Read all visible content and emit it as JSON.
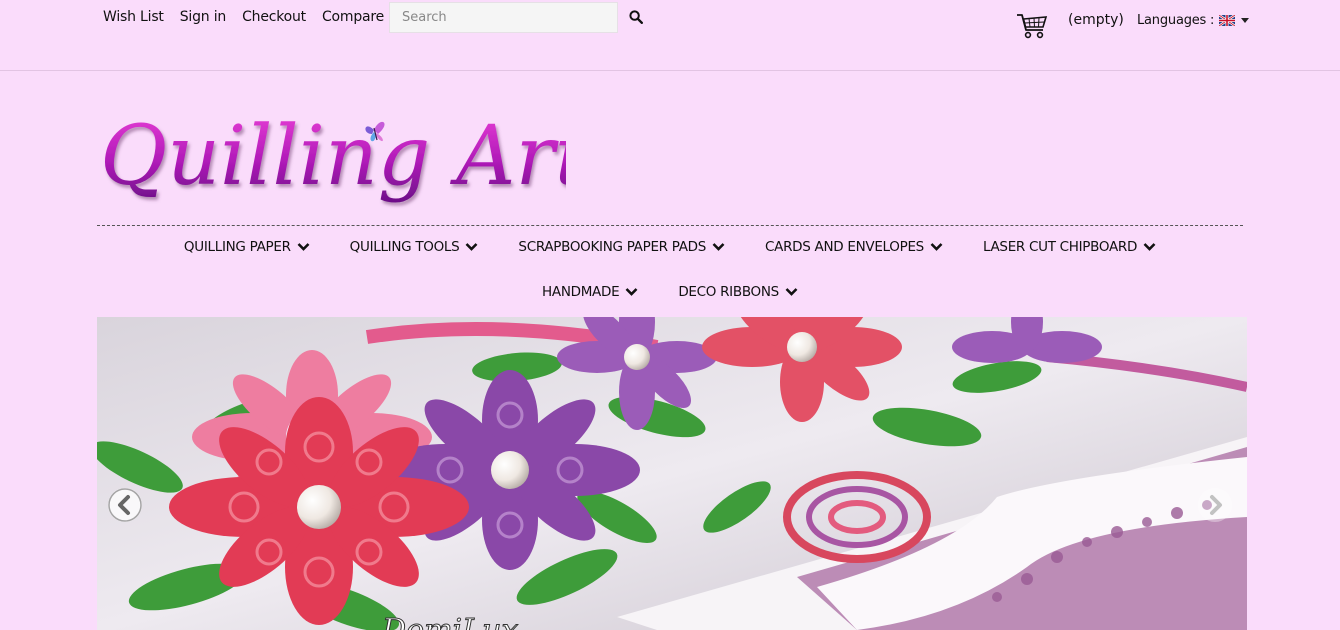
{
  "header": {
    "links": [
      "Wish List",
      "Sign in",
      "Checkout",
      "Compare"
    ],
    "search": {
      "placeholder": "Search",
      "value": ""
    },
    "cart": {
      "label": "(empty)",
      "icon": "cart-icon"
    },
    "languages": {
      "label": "Languages :",
      "selected_flag": "uk-flag-icon"
    }
  },
  "logo": {
    "text": "Quilling Art",
    "icon": "butterfly-icon"
  },
  "nav": {
    "row1": [
      "QUILLING PAPER",
      "QUILLING TOOLS",
      "SCRAPBOOKING PAPER PADS",
      "CARDS AND ENVELOPES",
      "LASER CUT CHIPBOARD"
    ],
    "row2": [
      "HANDMADE",
      "DECO RIBBONS"
    ]
  },
  "slider": {
    "watermark": "DomiLux",
    "prev_icon": "chevron-left-icon",
    "next_icon": "chevron-right-icon"
  },
  "colors": {
    "background": "#fadcfb",
    "logo_accent": "#b01ab8"
  }
}
